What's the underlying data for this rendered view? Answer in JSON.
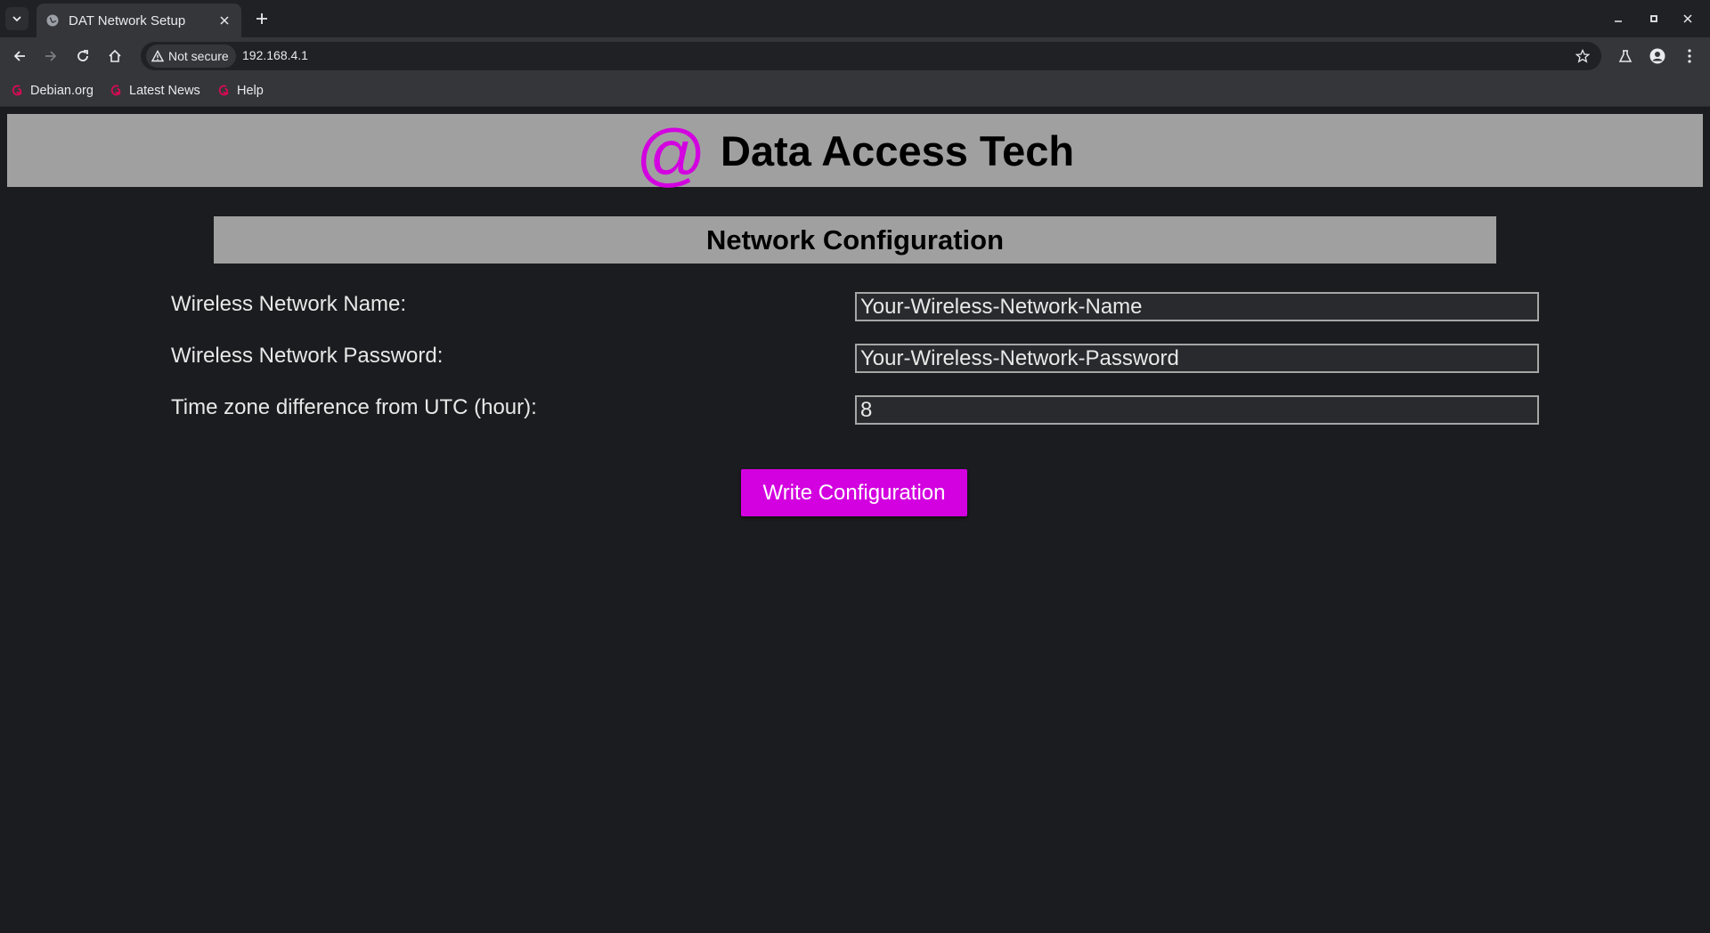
{
  "browser": {
    "tab": {
      "title": "DAT Network Setup"
    },
    "address": {
      "security_label": "Not secure",
      "url": "192.168.4.1"
    },
    "bookmarks": [
      {
        "label": "Debian.org"
      },
      {
        "label": "Latest News"
      },
      {
        "label": "Help"
      }
    ],
    "icons": {
      "tab_search": "chevron-down-icon",
      "favicon": "globe-icon",
      "close_tab": "close-icon",
      "new_tab": "plus-icon",
      "minimize": "minimize-icon",
      "maximize": "maximize-icon",
      "close_window": "close-icon",
      "back": "back-arrow-icon",
      "forward": "forward-arrow-icon",
      "reload": "reload-icon",
      "home": "home-icon",
      "warning": "warning-icon",
      "bookmark_star": "star-icon",
      "labs": "flask-icon",
      "profile": "profile-icon",
      "menu": "kebab-menu-icon",
      "bookmark_favicon": "debian-swirl-icon"
    }
  },
  "header": {
    "logo_symbol": "@",
    "brand_name": "Data Access Tech"
  },
  "section": {
    "title": "Network Configuration"
  },
  "form": {
    "fields": [
      {
        "label": "Wireless Network Name:",
        "value": "Your-Wireless-Network-Name"
      },
      {
        "label": "Wireless Network Password:",
        "value": "Your-Wireless-Network-Password"
      },
      {
        "label": "Time zone difference from UTC (hour):",
        "value": "8"
      }
    ],
    "submit_label": "Write Configuration"
  },
  "colors": {
    "accent": "#d300e0",
    "header_bar": "#a0a0a0",
    "page_background": "#1b1c1f",
    "input_background": "#292a2e",
    "debian_red": "#d70a53"
  }
}
